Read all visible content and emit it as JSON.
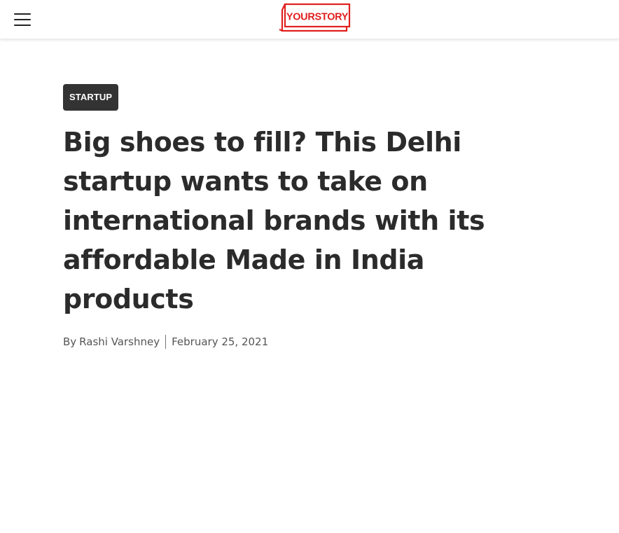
{
  "header": {
    "menu_icon": "hamburger-menu-icon",
    "logo_text": "YOURSTORY",
    "brand_color": "#e1201f"
  },
  "article": {
    "category": "STARTUP",
    "title": "Big shoes to fill? This Delhi startup wants to take on international brands with its affordable Made in India products",
    "byline_prefix": "By",
    "author": "Rashi Varshney",
    "date": "February 25, 2021"
  }
}
